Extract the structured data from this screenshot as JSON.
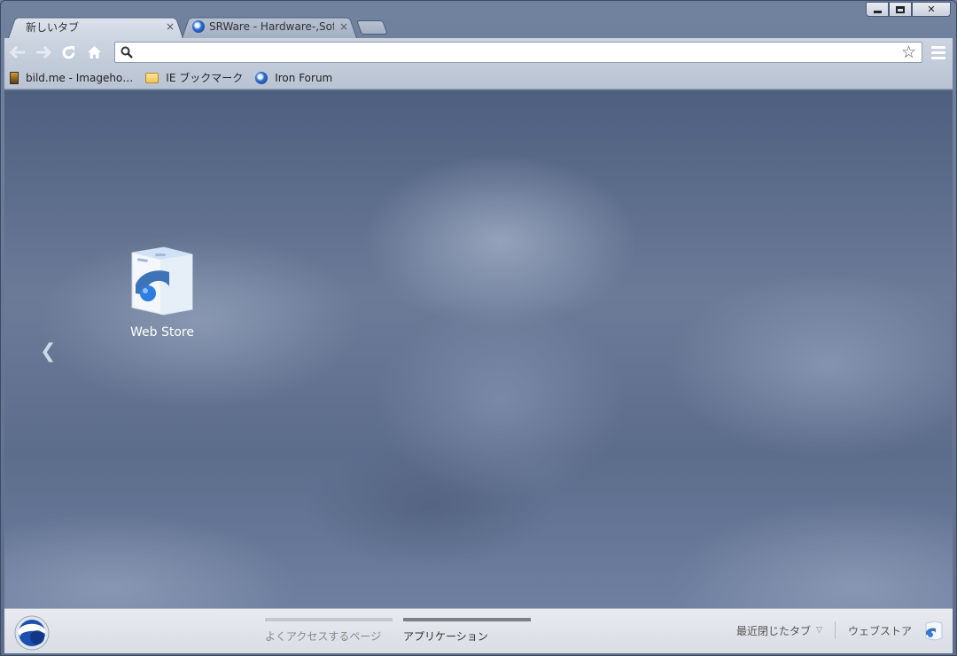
{
  "window": {
    "caption_buttons": [
      "minimize",
      "maximize",
      "close"
    ],
    "close_glyph": "✕"
  },
  "tabs": [
    {
      "label": "新しいタブ",
      "active": true,
      "close": "×"
    },
    {
      "label": "SRWare - Hardware-,Soft",
      "active": false,
      "close": "×",
      "icon": "iron-icon"
    }
  ],
  "toolbar": {
    "back": "back-arrow-icon",
    "forward": "forward-arrow-icon",
    "reload": "reload-icon",
    "home": "home-icon",
    "omnibox_value": "",
    "star": "☆",
    "menu": "menu-icon"
  },
  "bookmarks": [
    {
      "label": "bild.me - Imageho…",
      "icon": "page-icon"
    },
    {
      "label": "IE ブックマーク",
      "icon": "folder-icon"
    },
    {
      "label": "Iron Forum",
      "icon": "iron-icon"
    }
  ],
  "content": {
    "apps": [
      {
        "label": "Web Store",
        "icon": "web-store-icon"
      }
    ],
    "prev_page": "❮"
  },
  "footer": {
    "pages": [
      {
        "label": "よくアクセスするページ",
        "selected": false
      },
      {
        "label": "アプリケーション",
        "selected": true
      }
    ],
    "recently_closed": "最近閉じたタブ",
    "recently_closed_caret": "▽",
    "web_store": "ウェブストア"
  }
}
